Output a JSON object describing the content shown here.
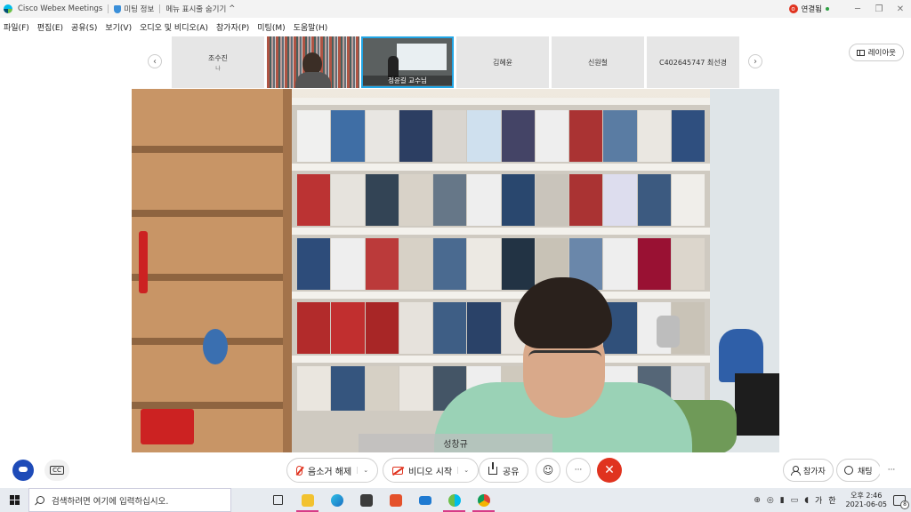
{
  "titlebar": {
    "app_name": "Cisco Webex Meetings",
    "meeting_info": "미팅 정보",
    "hide_menu": "메뉴 표시줄 숨기기",
    "hide_menu_chevron": "^",
    "connection_avatar": "o",
    "connection_status": "연결됨",
    "minimize": "─",
    "restore": "❐",
    "close": "✕"
  },
  "menu": [
    "파일(F)",
    "편집(E)",
    "공유(S)",
    "보기(V)",
    "오디오 및 비디오(A)",
    "참가자(P)",
    "미팅(M)",
    "도움말(H)"
  ],
  "participants": {
    "prev": "‹",
    "next": "›",
    "tiles": [
      {
        "name": "조수진",
        "sub": "나"
      },
      {
        "name": ""
      },
      {
        "name": "정윤길 교수님"
      },
      {
        "name": "김혜윤"
      },
      {
        "name": "신원철"
      },
      {
        "name": "C402645747 최선경"
      }
    ],
    "layout_label": "레이아웃"
  },
  "main_video": {
    "speaker_name": "성창규"
  },
  "controls": {
    "cc_label": "CC",
    "unmute_label": "음소거 해제",
    "video_label": "비디오 시작",
    "share_label": "공유",
    "chevron": "⌄",
    "reactions_icon": "☺",
    "more_icon": "···",
    "end_icon": "✕",
    "participants_label": "참가자",
    "chat_label": "채팅",
    "more_right_icon": "···"
  },
  "taskbar": {
    "search_placeholder": "검색하려면 여기에 입력하십시오.",
    "tray_icons": [
      "⊕",
      "◎",
      "▮",
      "▭",
      "◖"
    ],
    "ime_label": "가",
    "ime_mode": "한",
    "clock_time": "오후 2:46",
    "clock_date": "2021-06-05",
    "notification_count": "8"
  },
  "colors": {
    "accent_blue": "#21a6e6",
    "end_red": "#e0331f",
    "muted_red": "#e0331f"
  }
}
